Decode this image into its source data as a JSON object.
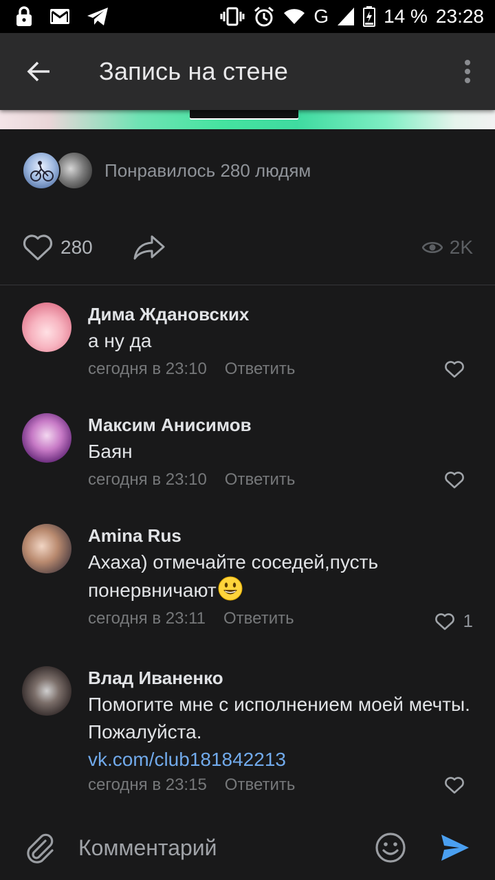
{
  "status_bar": {
    "battery_percent": "14 %",
    "time": "23:28",
    "network": "G"
  },
  "header": {
    "title": "Запись на стене"
  },
  "post": {
    "likes_text": "Понравилось 280 людям",
    "likes_count": "280",
    "views_count": "2K"
  },
  "comments": [
    {
      "author": "Дима Ждановских",
      "text": "а ну да",
      "time": "сегодня в 23:10",
      "reply_label": "Ответить",
      "likes": ""
    },
    {
      "author": "Максим Анисимов",
      "text": "Баян",
      "time": "сегодня в 23:10",
      "reply_label": "Ответить",
      "likes": ""
    },
    {
      "author": "Amina Rus",
      "text": "Ахаха) отмечайте соседей,пусть понервничают",
      "time": "сегодня в 23:11",
      "reply_label": "Ответить",
      "likes": "1"
    },
    {
      "author": "Влад Иваненко",
      "text": "Помогите мне с исполнением моей мечты. Пожалуйста.",
      "link": "vk.com/club181842213",
      "time": "сегодня в 23:15",
      "reply_label": "Ответить",
      "likes": ""
    }
  ],
  "composer": {
    "placeholder": "Комментарий"
  },
  "colors": {
    "background": "#19191a",
    "appbar": "#2b2b2c",
    "link": "#71aaeb",
    "send_accent": "#4a9ff0",
    "secondary_text": "#76787a"
  },
  "icons": [
    "lock-icon",
    "mail-icon",
    "telegram-icon",
    "vibrate-icon",
    "alarm-icon",
    "wifi-icon",
    "signal-icon",
    "battery-icon",
    "back-arrow-icon",
    "more-vert-icon",
    "heart-icon",
    "share-icon",
    "eye-icon",
    "smile-emoji-icon",
    "attach-icon",
    "emoji-icon",
    "send-icon"
  ]
}
